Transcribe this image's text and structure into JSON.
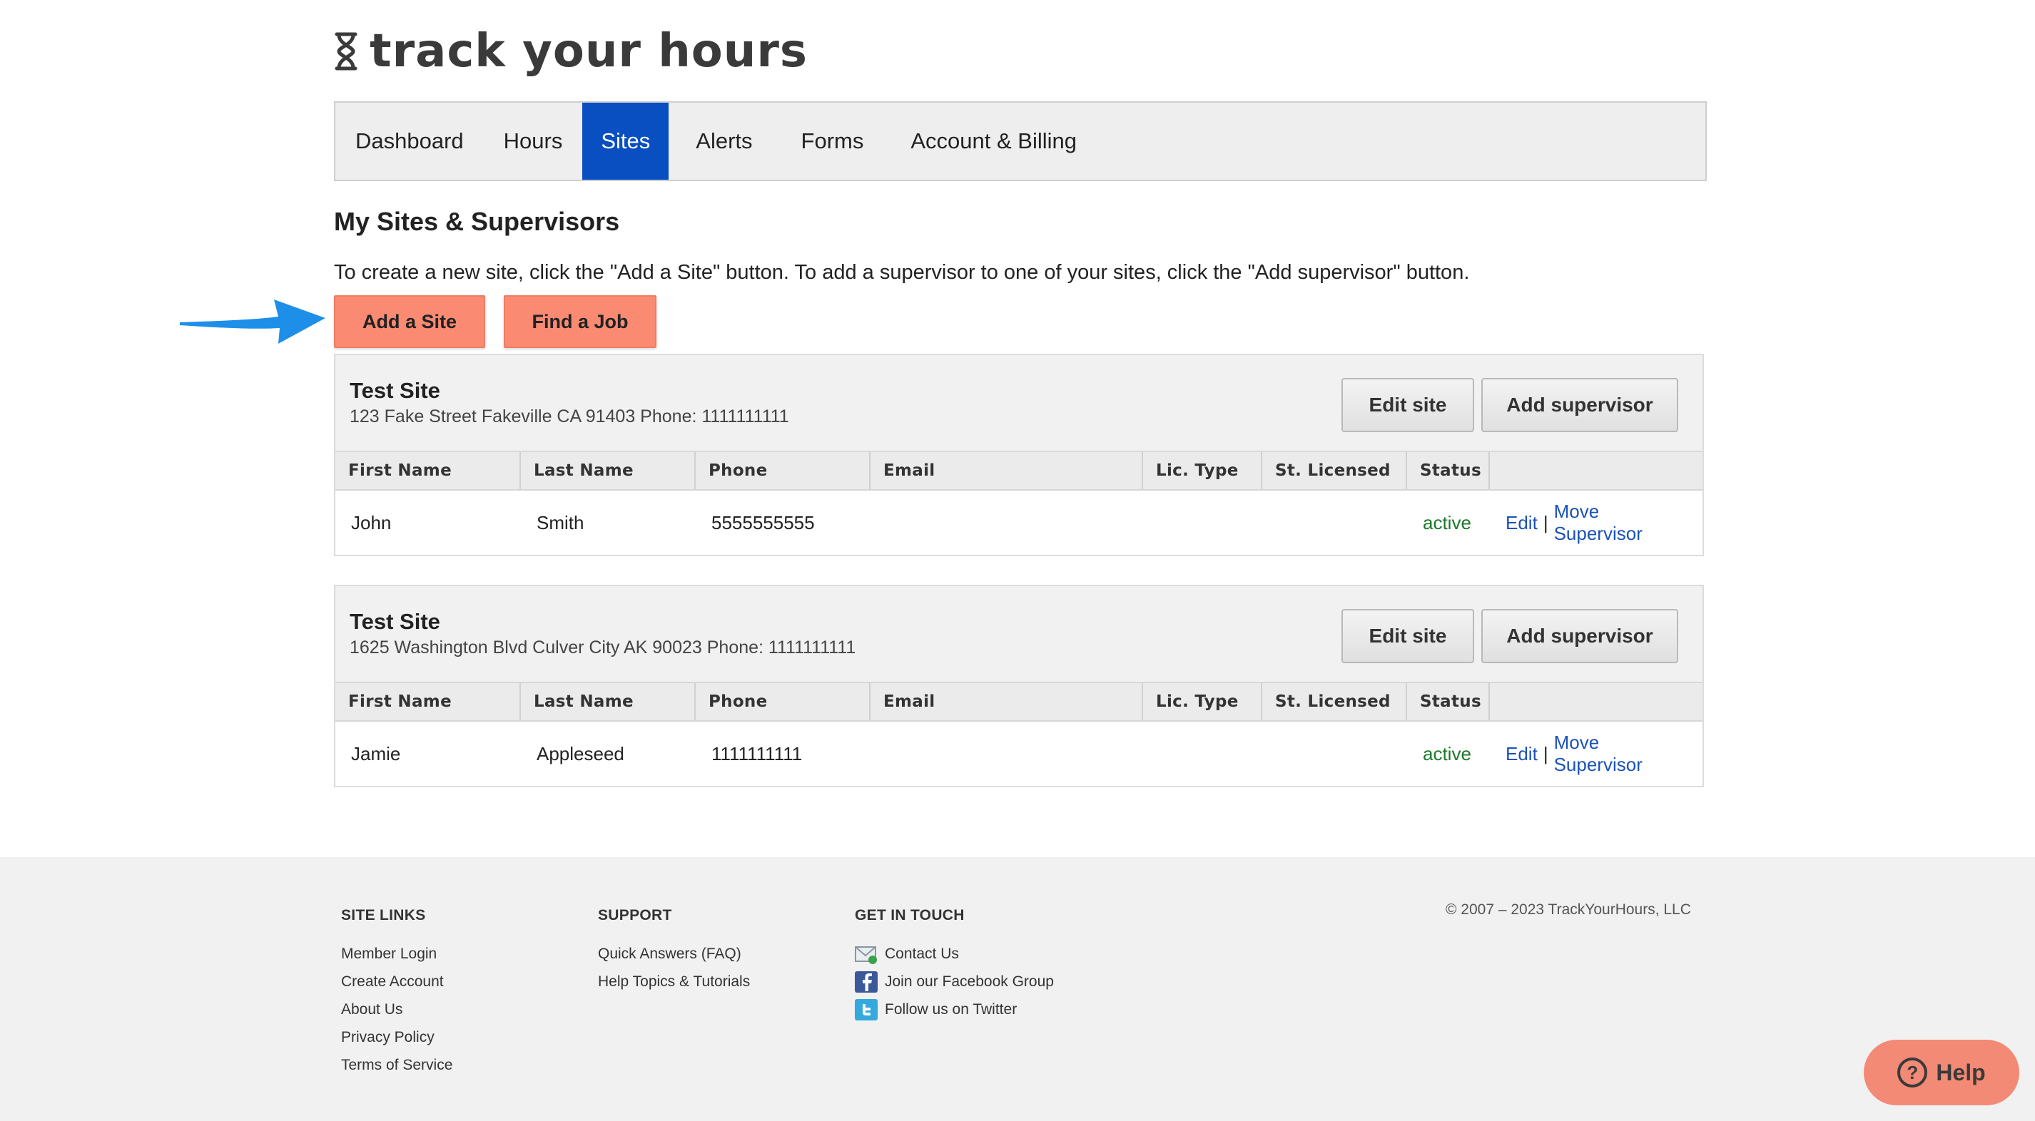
{
  "logo": {
    "text": "track your hours",
    "icon": "hourglass-icon"
  },
  "nav": {
    "items": [
      {
        "label": "Dashboard",
        "active": false
      },
      {
        "label": "Hours",
        "active": false
      },
      {
        "label": "Sites",
        "active": true
      },
      {
        "label": "Alerts",
        "active": false
      },
      {
        "label": "Forms",
        "active": false
      },
      {
        "label": "Account & Billing",
        "active": false
      }
    ]
  },
  "page": {
    "title": "My Sites & Supervisors",
    "intro": "To create a new site, click the \"Add a Site\" button. To add a supervisor to one of your sites, click the \"Add supervisor\" button.",
    "add_site_label": "Add a Site",
    "find_job_label": "Find a Job"
  },
  "table_headers": [
    "First Name",
    "Last Name",
    "Phone",
    "Email",
    "Lic. Type",
    "St. Licensed",
    "Status",
    ""
  ],
  "sites": [
    {
      "name": "Test Site",
      "address": "123 Fake Street Fakeville CA 91403 Phone: 1111111111",
      "edit_label": "Edit site",
      "add_label": "Add supervisor",
      "rows": [
        {
          "first": "John",
          "last": "Smith",
          "phone": "5555555555",
          "email": "",
          "lic_type": "",
          "st_licensed": "",
          "status": "active",
          "edit": "Edit",
          "sep": "|",
          "move": "Move Supervisor"
        }
      ]
    },
    {
      "name": "Test Site",
      "address": "1625 Washington Blvd Culver City AK 90023 Phone: 1111111111",
      "edit_label": "Edit site",
      "add_label": "Add supervisor",
      "rows": [
        {
          "first": "Jamie",
          "last": "Appleseed",
          "phone": "1111111111",
          "email": "",
          "lic_type": "",
          "st_licensed": "",
          "status": "active",
          "edit": "Edit",
          "sep": "|",
          "move": "Move Supervisor"
        }
      ]
    }
  ],
  "footer": {
    "site_links": {
      "heading": "SITE LINKS",
      "items": [
        "Member Login",
        "Create Account",
        "About Us",
        "Privacy Policy",
        "Terms of Service"
      ]
    },
    "support": {
      "heading": "SUPPORT",
      "items": [
        "Quick Answers (FAQ)",
        "Help Topics & Tutorials"
      ]
    },
    "get_in_touch": {
      "heading": "GET IN TOUCH",
      "items": [
        {
          "label": "Contact Us",
          "icon": "mail-icon"
        },
        {
          "label": "Join our Facebook Group",
          "icon": "facebook-icon"
        },
        {
          "label": "Follow us on Twitter",
          "icon": "twitter-icon"
        }
      ]
    },
    "copyright": "© 2007 – 2023 TrackYourHours, LLC"
  },
  "help": {
    "label": "Help",
    "icon": "question-icon",
    "glyph": "?"
  },
  "colors": {
    "nav_active": "#0a4fc2",
    "accent_button": "#fa8a72",
    "link": "#1a52b8",
    "status_active": "#1b7a2b",
    "arrow": "#1e8fe8"
  }
}
